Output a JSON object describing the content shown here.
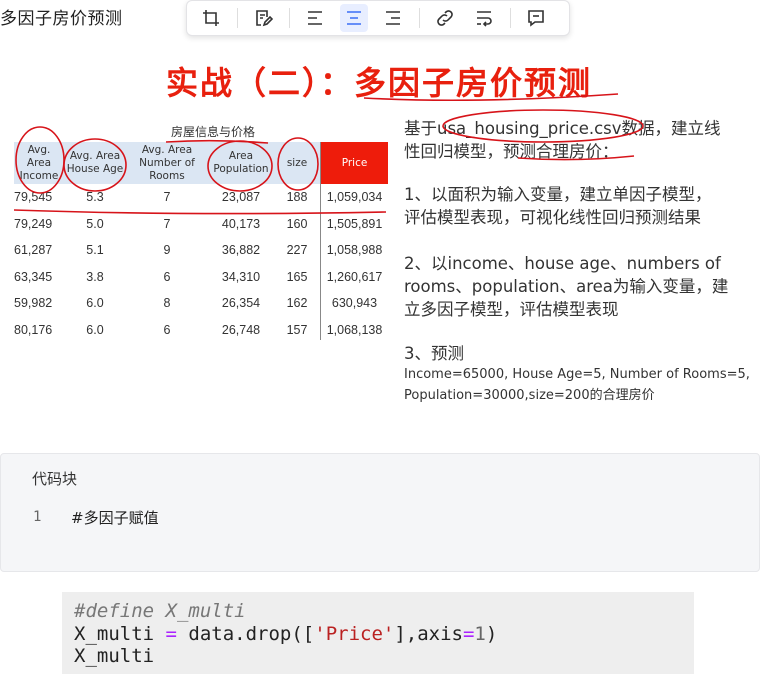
{
  "doc": {
    "title": "多因子房价预测"
  },
  "toolbar": {
    "items": [
      {
        "name": "crop-icon"
      },
      {
        "name": "edit-note-icon"
      },
      {
        "name": "align-left-icon"
      },
      {
        "name": "align-center-icon",
        "active": true
      },
      {
        "name": "align-right-icon"
      },
      {
        "name": "link-icon"
      },
      {
        "name": "text-wrap-icon"
      },
      {
        "name": "comment-icon"
      }
    ]
  },
  "slide": {
    "title": "实战（二）：多因子房价预测",
    "table_caption": "房屋信息与价格",
    "headers": [
      "Avg.\nArea\nIncome",
      "Avg. Area\nHouse Age",
      "Avg. Area\nNumber of\nRooms",
      "Area\nPopulation",
      "size",
      "Price"
    ],
    "rows": [
      [
        "79,545",
        "5.3",
        "7",
        "23,087",
        "188",
        "1,059,034"
      ],
      [
        "79,249",
        "5.0",
        "7",
        "40,173",
        "160",
        "1,505,891"
      ],
      [
        "61,287",
        "5.1",
        "9",
        "36,882",
        "227",
        "1,058,988"
      ],
      [
        "63,345",
        "3.8",
        "6",
        "34,310",
        "165",
        "1,260,617"
      ],
      [
        "59,982",
        "6.0",
        "8",
        "26,354",
        "162",
        "630,943"
      ],
      [
        "80,176",
        "6.0",
        "6",
        "26,748",
        "157",
        "1,068,138"
      ]
    ],
    "intro_line1": "基于usa_housing_price.csv数据，建立线",
    "intro_line2": "性回归模型，预测合理房价：",
    "task1_line1": "1、以面积为输入变量，建立单因子模型，",
    "task1_line2": "评估模型表现，可视化线性回归预测结果",
    "task2_line1": "2、以income、house age、numbers of",
    "task2_line2": "rooms、population、area为输入变量，建",
    "task2_line3": "立多因子模型，评估模型表现",
    "task3_title": "3、预测",
    "task3_line1": "Income=65000, House Age=5, Number of Rooms=5,",
    "task3_line2": "Population=30000,size=200的合理房价",
    "colors": {
      "title": "#e8200e",
      "header_bg": "#dbe6f3",
      "price_bg": "#ee1c0b",
      "annotation": "#d7141a"
    }
  },
  "code_block": {
    "title": "代码块",
    "line_number": "1",
    "line_text": "#多因子赋值"
  },
  "notebook": {
    "comment": "#define X_multi",
    "line2_a": "X_multi ",
    "line2_eq": "=",
    "line2_b": " data.drop([",
    "line2_str": "'Price'",
    "line2_c": "],axis",
    "line2_eq2": "=",
    "line2_num": "1",
    "line2_d": ")",
    "line3": "X_multi"
  }
}
